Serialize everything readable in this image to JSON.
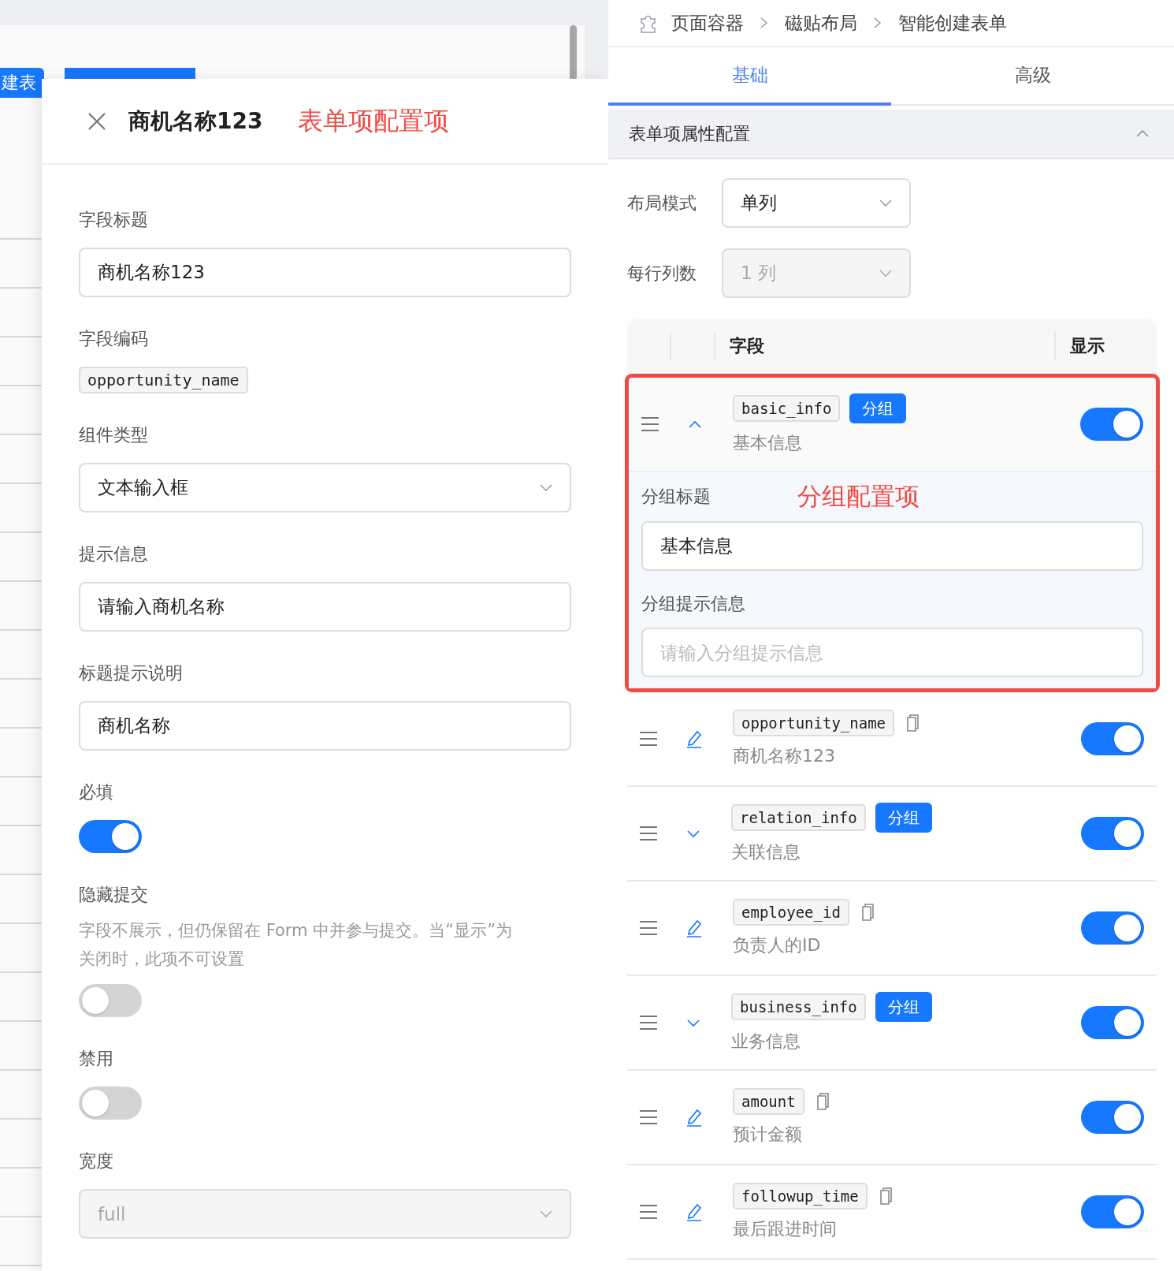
{
  "background": {
    "tabs": [
      {
        "label": "建表"
      }
    ]
  },
  "drawer": {
    "title": "商机名称123",
    "annotation": "表单项配置项",
    "fields": [
      {
        "kind": "input",
        "label": "字段标题",
        "value": "商机名称123"
      },
      {
        "kind": "code",
        "label": "字段编码",
        "value": "opportunity_name"
      },
      {
        "kind": "select",
        "label": "组件类型",
        "value": "文本输入框",
        "disabled": false
      },
      {
        "kind": "input",
        "label": "提示信息",
        "value": "请输入商机名称"
      },
      {
        "kind": "input",
        "label": "标题提示说明",
        "value": "商机名称"
      },
      {
        "kind": "switch",
        "label": "必填",
        "on": true
      },
      {
        "kind": "switch",
        "label": "隐藏提交",
        "description": "字段不展示，但仍保留在 Form 中并参与提交。当“显示”为关闭时，此项不可设置",
        "on": false
      },
      {
        "kind": "switch",
        "label": "禁用",
        "on": false
      },
      {
        "kind": "select",
        "label": "宽度",
        "value": "full",
        "disabled": true
      }
    ]
  },
  "breadcrumb": [
    "页面容器",
    "磁贴布局",
    "智能创建表单"
  ],
  "tabs": [
    {
      "label": "基础",
      "selected": true
    },
    {
      "label": "高级",
      "selected": false
    }
  ],
  "section": {
    "title": "表单项属性配置",
    "expanded": true,
    "settings": [
      {
        "label": "布局模式",
        "value": "单列",
        "disabled": false
      },
      {
        "label": "每行列数",
        "value": "1 列",
        "disabled": true
      }
    ],
    "table": {
      "columns": [
        "字段",
        "显示"
      ],
      "rows": [
        {
          "kind": "group",
          "code": "basic_info",
          "badge": "分组",
          "label": "基本信息",
          "expanded": true,
          "visible": true,
          "highlighted": true,
          "group_config": {
            "annotation": "分组配置项",
            "title_label": "分组标题",
            "title_value": "基本信息",
            "hint_label": "分组提示信息",
            "hint_placeholder": "请输入分组提示信息"
          }
        },
        {
          "kind": "field",
          "code": "opportunity_name",
          "label": "商机名称123",
          "visible": true,
          "highlighted": false
        },
        {
          "kind": "group",
          "code": "relation_info",
          "badge": "分组",
          "label": "关联信息",
          "expanded": false,
          "visible": true,
          "highlighted": false
        },
        {
          "kind": "field",
          "code": "employee_id",
          "label": "负责人的ID",
          "visible": true,
          "highlighted": false
        },
        {
          "kind": "group",
          "code": "business_info",
          "badge": "分组",
          "label": "业务信息",
          "expanded": false,
          "visible": true,
          "highlighted": false
        },
        {
          "kind": "field",
          "code": "amount",
          "label": "预计金额",
          "visible": true,
          "highlighted": false
        },
        {
          "kind": "field",
          "code": "followup_time",
          "label": "最后跟进时间",
          "visible": true,
          "highlighted": false
        }
      ]
    }
  }
}
